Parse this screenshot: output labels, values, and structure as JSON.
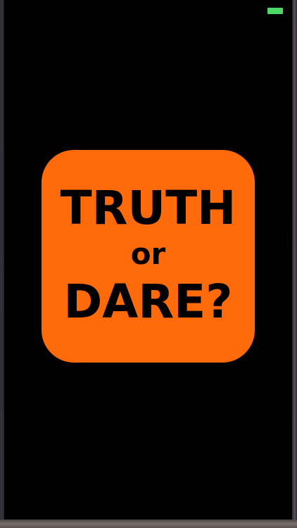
{
  "status_bar": {
    "battery_icon": "battery-full-icon",
    "battery_color": "#4cd964"
  },
  "splash": {
    "logo_color": "#ff6a0a",
    "line1": "TRUTH",
    "line2": "or",
    "line3": "DARE?"
  }
}
